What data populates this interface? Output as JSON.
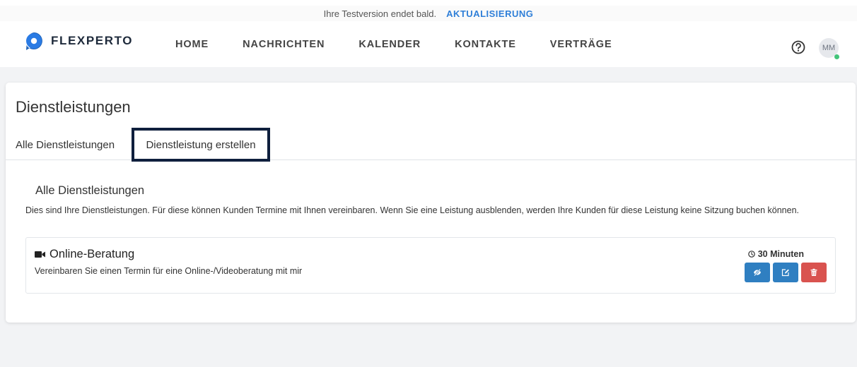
{
  "trial_banner": {
    "text": "Ihre Testversion endet bald.",
    "action": "AKTUALISIERUNG"
  },
  "brand": {
    "name": "FLEXPERTO",
    "logo_icon": "flexperto-logo-icon"
  },
  "nav": {
    "items": [
      {
        "label": "HOME"
      },
      {
        "label": "NACHRICHTEN"
      },
      {
        "label": "KALENDER"
      },
      {
        "label": "KONTAKTE"
      },
      {
        "label": "VERTRÄGE"
      }
    ],
    "help_icon": "question-circle-icon",
    "avatar_initials": "MM",
    "status_color": "#43c47a"
  },
  "page": {
    "title": "Dienstleistungen",
    "tabs": [
      {
        "label": "Alle Dienstleistungen",
        "active": false
      },
      {
        "label": "Dienstleistung erstellen",
        "active": true
      }
    ]
  },
  "section": {
    "title": "Alle Dienstleistungen",
    "description": "Dies sind Ihre Dienstleistungen. Für diese können Kunden Termine mit Ihnen vereinbaren. Wenn Sie eine Leistung ausblenden, werden Ihre Kunden für diese Leistung keine Sitzung buchen können."
  },
  "services": [
    {
      "icon": "video-camera-icon",
      "name": "Online-Beratung",
      "description": "Vereinbaren Sie einen Termin für eine Online-/Videoberatung mit mir",
      "duration": "30 Minuten",
      "actions": [
        "hide-icon",
        "edit-icon",
        "trash-icon"
      ]
    }
  ],
  "colors": {
    "accent": "#2f7fd8",
    "button_blue": "#2f7fc1",
    "button_red": "#d9534f",
    "highlight_border": "#0f1f3d"
  }
}
